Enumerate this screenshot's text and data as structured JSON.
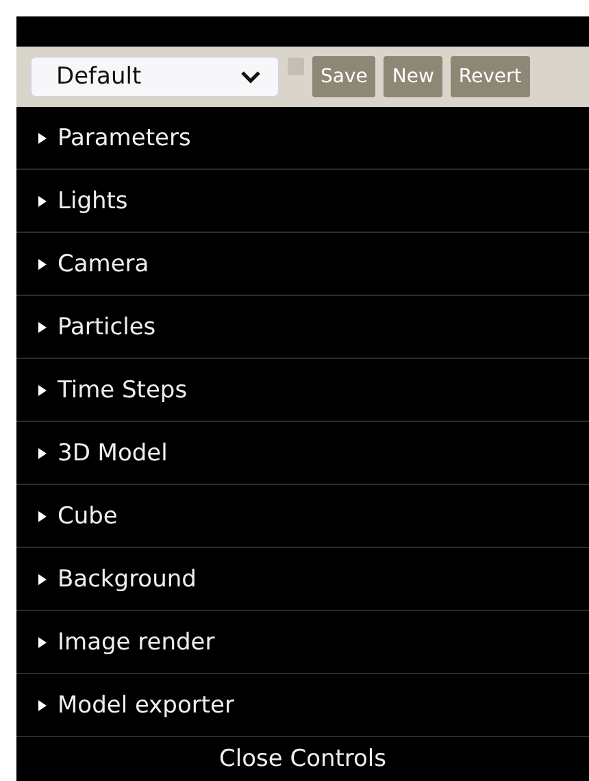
{
  "preset_bar": {
    "preset": "Default",
    "remember_checkbox": {
      "checked": false
    },
    "buttons": [
      "Save",
      "New",
      "Revert"
    ]
  },
  "folders": [
    {
      "label": "Parameters",
      "expanded": false
    },
    {
      "label": "Lights",
      "expanded": false
    },
    {
      "label": "Camera",
      "expanded": false
    },
    {
      "label": "Particles",
      "expanded": false
    },
    {
      "label": "Time Steps",
      "expanded": false
    },
    {
      "label": "3D Model",
      "expanded": false
    },
    {
      "label": "Cube",
      "expanded": false
    },
    {
      "label": "Background",
      "expanded": false
    },
    {
      "label": "Image render",
      "expanded": false
    },
    {
      "label": "Model exporter",
      "expanded": false
    }
  ],
  "close_button": "Close Controls"
}
